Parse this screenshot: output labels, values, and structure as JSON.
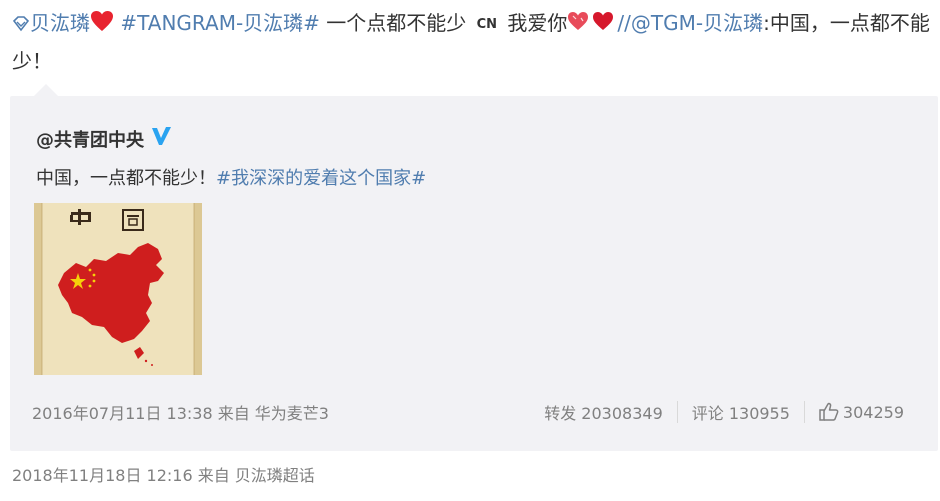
{
  "post": {
    "author_icon": "diamond-badge-icon",
    "author": "贝汯璘",
    "heart_icon": "red-heart-icon",
    "hashtag": "#TANGRAM-贝汯璘#",
    "text1": "一个点都不能少",
    "cn_badge": "CN",
    "text2": "我爱你",
    "hearts_icon": "two-hearts-icon",
    "mention": "//@TGM-贝汯璘",
    "text3": ":中国，一点都不能少！"
  },
  "repost": {
    "user": "@共青团中央",
    "verify_icon": "blue-v-verified-icon",
    "text": "中国，一点都不能少！",
    "topic": "#我深深的爱着这个国家#",
    "image_alt_icon": "china-map-image",
    "meta": "2016年07月11日 13:38 来自 华为麦芒3",
    "repost_label": "转发 20308349",
    "comment_label": "评论 130955",
    "like_icon": "thumbs-up-icon",
    "like_count": "304259"
  },
  "footer": {
    "meta": "2018年11月18日 12:16  来自 贝汯璘超话"
  },
  "colors": {
    "link_blue": "#507daf",
    "repost_bg": "#f2f2f5",
    "meta_gray": "#808080",
    "heart_red": "#e8232f"
  }
}
